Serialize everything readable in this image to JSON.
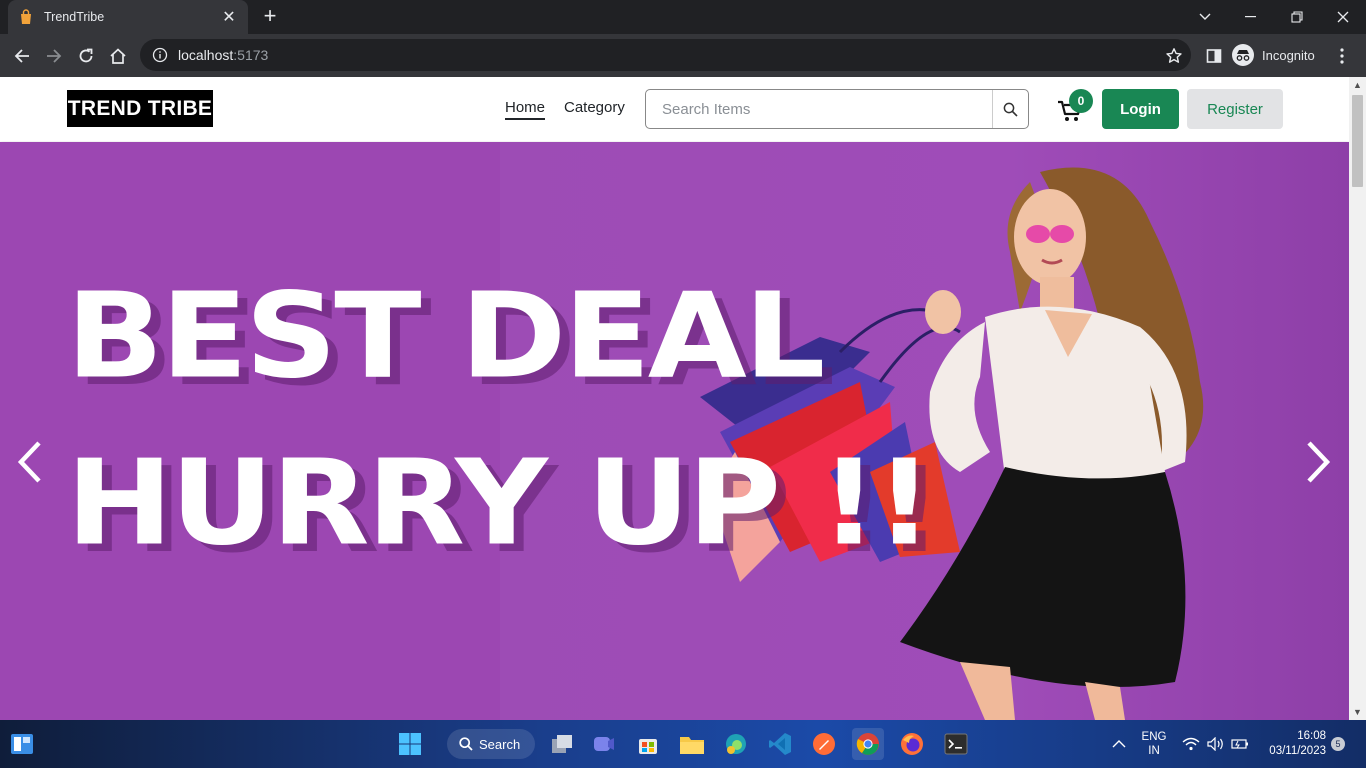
{
  "browser": {
    "tab_title": "TrendTribe",
    "url_host": "localhost",
    "url_port": ":5173",
    "profile_label": "Incognito"
  },
  "nav": {
    "logo": "TREND TRIBE",
    "links": [
      "Home",
      "Category"
    ],
    "search_placeholder": "Search Items",
    "cart_count": "0",
    "login_label": "Login",
    "register_label": "Register"
  },
  "hero": {
    "line1": "BEST DEAL",
    "line2": "HURRY UP  !!",
    "background_color": "#9c47b2"
  },
  "taskbar": {
    "search_label": "Search",
    "lang_line1": "ENG",
    "lang_line2": "IN",
    "time": "16:08",
    "date": "03/11/2023",
    "notification_count": "5"
  },
  "colors": {
    "accent_green": "#198754",
    "chrome_dark": "#202124",
    "chrome_toolbar": "#35363a"
  }
}
